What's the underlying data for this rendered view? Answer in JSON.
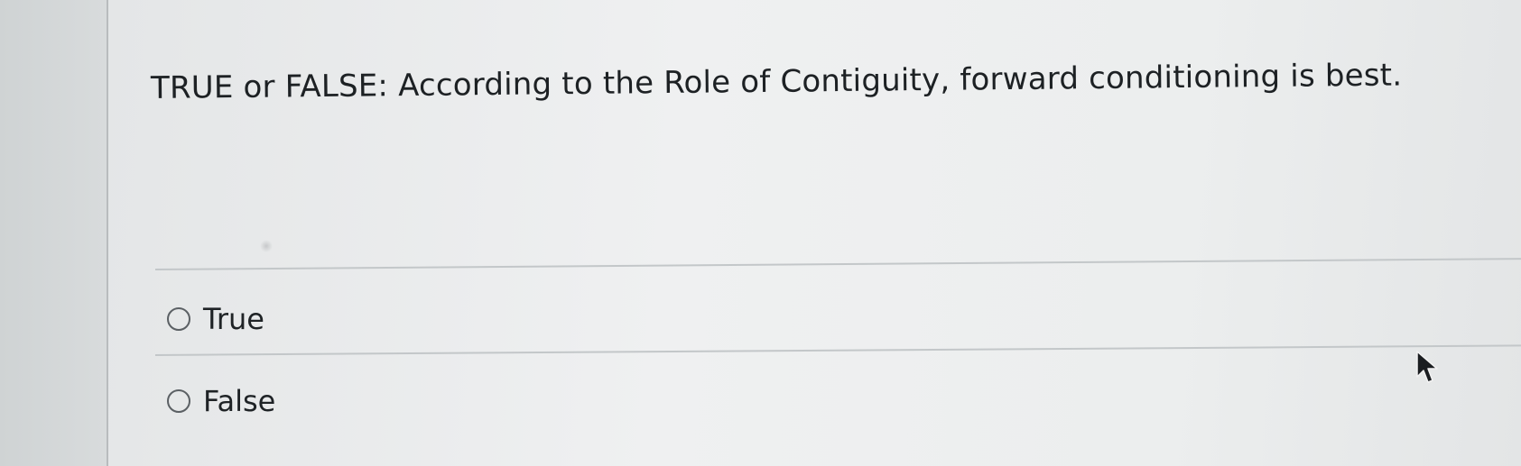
{
  "question": {
    "text": "TRUE or FALSE: According to the Role of Contiguity, forward conditioning is best."
  },
  "options": [
    {
      "label": "True",
      "selected": false
    },
    {
      "label": "False",
      "selected": false
    }
  ],
  "colors": {
    "text": "#1f2326",
    "radio_border": "#5b6064",
    "divider": "#c3c7c9"
  },
  "icons": {
    "cursor": "arrow-cursor-icon",
    "radio": "radio-unchecked-icon"
  }
}
